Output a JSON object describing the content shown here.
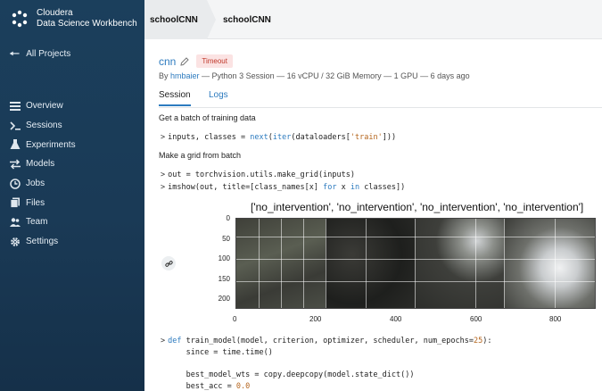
{
  "sidebar": {
    "brand_line1": "Cloudera",
    "brand_line2": "Data Science Workbench",
    "back_label": "All Projects",
    "items": [
      {
        "label": "Overview",
        "icon": "list-icon"
      },
      {
        "label": "Sessions",
        "icon": "terminal-icon"
      },
      {
        "label": "Experiments",
        "icon": "flask-icon"
      },
      {
        "label": "Models",
        "icon": "arrows-icon"
      },
      {
        "label": "Jobs",
        "icon": "clock-icon"
      },
      {
        "label": "Files",
        "icon": "files-icon"
      },
      {
        "label": "Team",
        "icon": "team-icon"
      },
      {
        "label": "Settings",
        "icon": "gear-icon"
      }
    ]
  },
  "header": {
    "crumb_project": "schoolCNN",
    "crumb_current": "schoolCNN"
  },
  "session": {
    "title": "cnn",
    "status": "Timeout",
    "meta_by": "By",
    "meta_user": "hmbaier",
    "meta_rest": " — Python 3 Session — 16 vCPU / 32 GiB Memory — 1 GPU — 6 days ago"
  },
  "tabs": {
    "session": "Session",
    "logs": "Logs"
  },
  "content": {
    "text1": "Get a batch of training data",
    "code1": {
      "a": "inputs, classes = ",
      "b": "next",
      "c": "(",
      "d": "iter",
      "e": "(dataloaders[",
      "f": "'train'",
      "g": "]))"
    },
    "text2": "Make a grid from batch",
    "code2": "out = torchvision.utils.make_grid(inputs)",
    "code3": {
      "a": "imshow(out, title=[class_names[x] ",
      "b": "for",
      "c": " x ",
      "d": "in",
      "e": " classes])"
    },
    "fig_title": "['no_intervention', 'no_intervention', 'no_intervention', 'no_intervention']",
    "yticks": [
      "0",
      "50",
      "100",
      "150",
      "200"
    ],
    "xticks": [
      "0",
      "200",
      "400",
      "600",
      "800"
    ],
    "code4": {
      "a": "def",
      "b": " train_model(model, criterion, optimizer, scheduler, num_epochs=",
      "c": "25",
      "d": "):"
    },
    "code5": "    since = time.time()",
    "code6": "    best_model_wts = copy.deepcopy(model.state_dict())",
    "code7": {
      "a": "    best_acc = ",
      "b": "0.0"
    }
  },
  "colors": {
    "sidebar": "#1b3f5c",
    "accent": "#2d7bbf",
    "badge_bg": "#fbe3e3",
    "badge_fg": "#c0392b"
  }
}
